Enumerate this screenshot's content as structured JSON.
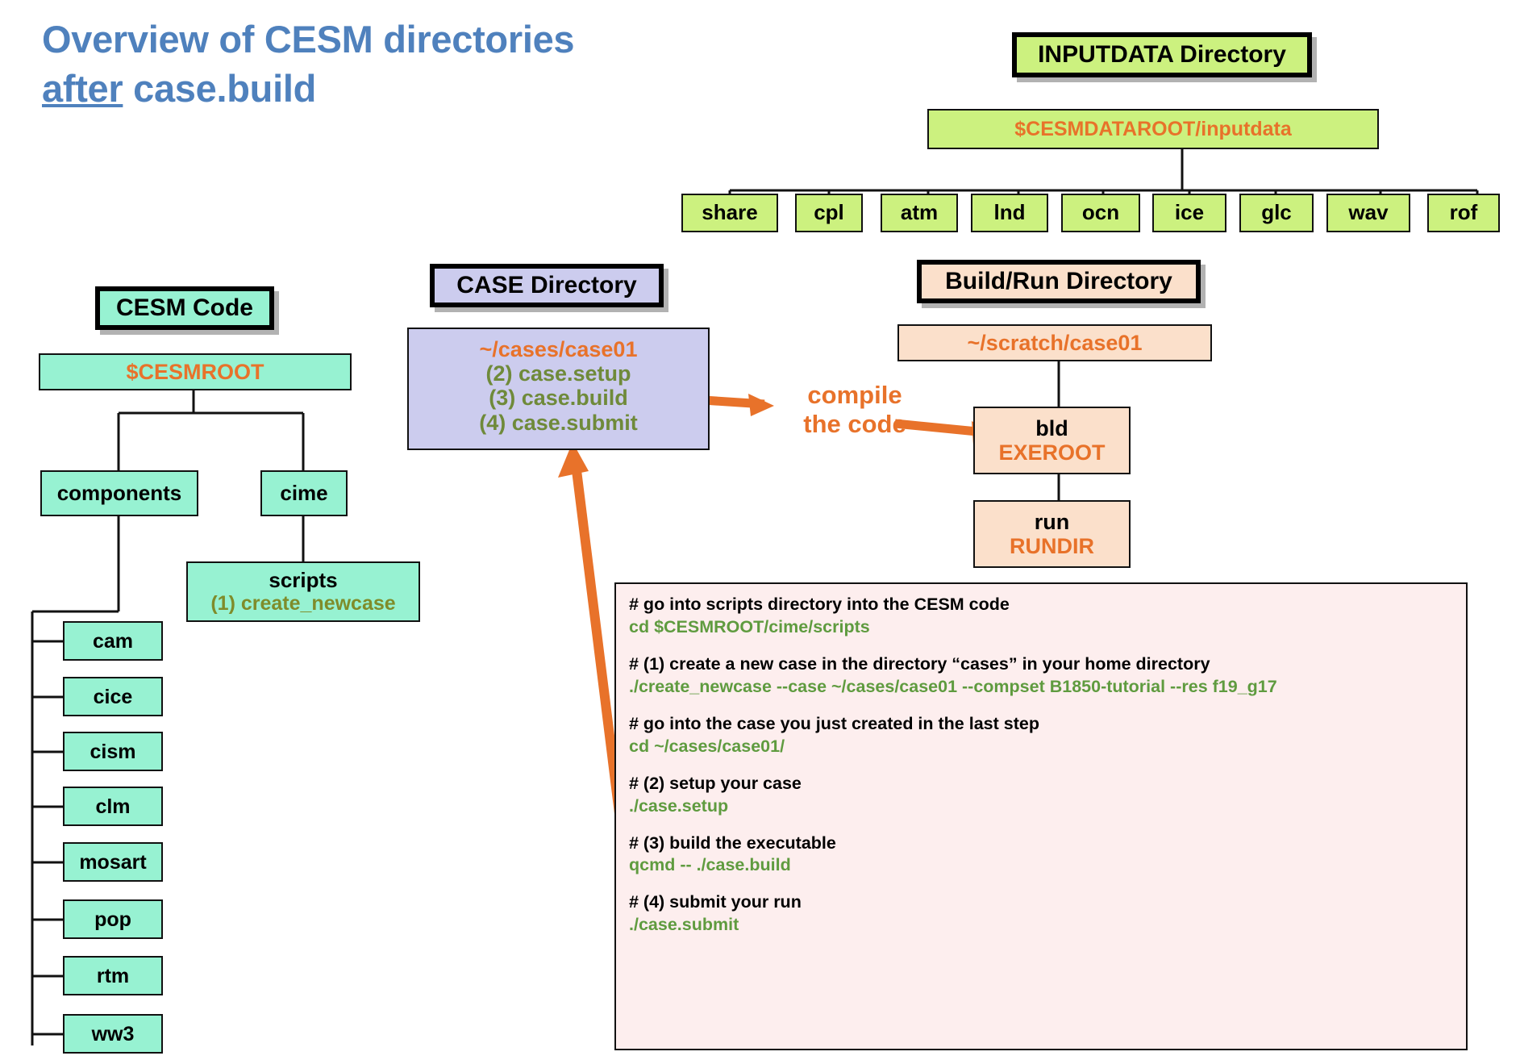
{
  "title": {
    "line1": "Overview of CESM directories",
    "line2_underlined": "after",
    "line2_rest": " case.build"
  },
  "colors": {
    "title": "#4f81bd",
    "green": "#ccf17f",
    "mint": "#97f2d2",
    "lavender": "#ccccee",
    "peach": "#fbe0cb",
    "orange": "#e8722a",
    "olive": "#7f8c2a",
    "code_bg": "#fdeeee",
    "code_cmd": "#5f9b3f"
  },
  "inputdata": {
    "header": "INPUTDATA Directory",
    "root": "$CESMDATAROOT/inputdata",
    "children": [
      "share",
      "cpl",
      "atm",
      "lnd",
      "ocn",
      "ice",
      "glc",
      "wav",
      "rof"
    ]
  },
  "cesm_code": {
    "header": "CESM Code",
    "root": "$CESMROOT",
    "components_label": "components",
    "cime_label": "cime",
    "scripts_label": "scripts",
    "scripts_sub": "(1) create_newcase",
    "components": [
      "cam",
      "cice",
      "cism",
      "clm",
      "mosart",
      "pop",
      "rtm",
      "ww3"
    ]
  },
  "case_dir": {
    "header": "CASE Directory",
    "path": "~/cases/case01",
    "steps": [
      "(2) case.setup",
      "(3) case.build",
      "(4) case.submit"
    ],
    "highlighted_step": "(3) case.build"
  },
  "build_run": {
    "header": "Build/Run Directory",
    "path": "~/scratch/case01",
    "bld_label": "bld",
    "bld_var": "EXEROOT",
    "run_label": "run",
    "run_var": "RUNDIR"
  },
  "annotation": {
    "compile_line1": "compile",
    "compile_line2": "the code"
  },
  "code_block": {
    "lines": [
      {
        "type": "comment",
        "text": "# go into scripts directory into the CESM code"
      },
      {
        "type": "command",
        "text": "cd $CESMROOT/cime/scripts"
      },
      {
        "type": "blank",
        "text": ""
      },
      {
        "type": "comment",
        "text": "# (1) create a new case in the directory “cases” in your home directory"
      },
      {
        "type": "command",
        "text": "./create_newcase --case ~/cases/case01 --compset B1850-tutorial --res f19_g17"
      },
      {
        "type": "blank",
        "text": ""
      },
      {
        "type": "comment",
        "text": "# go into the case you just created in the last step"
      },
      {
        "type": "command",
        "text": "cd ~/cases/case01/"
      },
      {
        "type": "blank",
        "text": ""
      },
      {
        "type": "comment",
        "text": "# (2) setup your case"
      },
      {
        "type": "command",
        "text": "./case.setup"
      },
      {
        "type": "blank",
        "text": ""
      },
      {
        "type": "comment",
        "text": "# (3) build the executable"
      },
      {
        "type": "command",
        "text": "qcmd -- ./case.build"
      },
      {
        "type": "blank",
        "text": ""
      },
      {
        "type": "comment",
        "text": "# (4) submit your run"
      },
      {
        "type": "command",
        "text": "./case.submit"
      }
    ]
  }
}
